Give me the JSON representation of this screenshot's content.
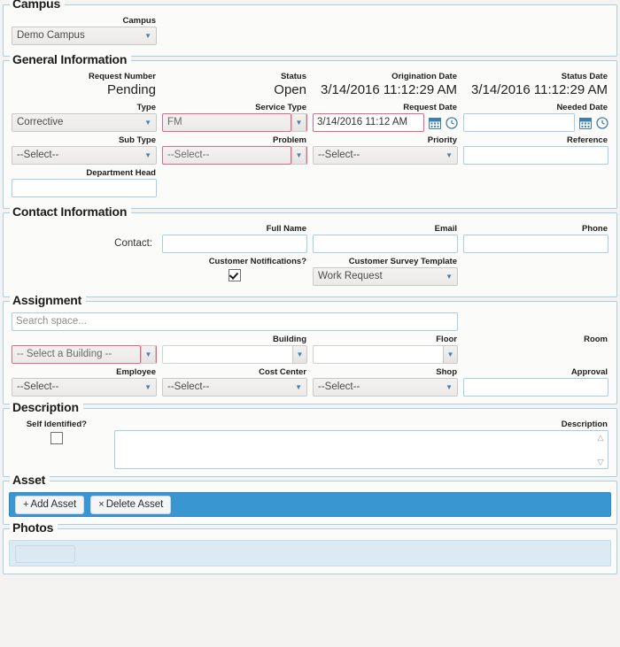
{
  "sections": {
    "campus": {
      "legend": "Campus",
      "campus_label": "Campus",
      "campus_value": "Demo Campus"
    },
    "general": {
      "legend": "General Information",
      "request_number_label": "Request Number",
      "request_number_value": "Pending",
      "status_label": "Status",
      "status_value": "Open",
      "origination_date_label": "Origination Date",
      "origination_date_value": "3/14/2016 11:12:29 AM",
      "status_date_label": "Status Date",
      "status_date_value": "3/14/2016 11:12:29 AM",
      "type_label": "Type",
      "type_value": "Corrective",
      "service_type_label": "Service Type",
      "service_type_value": "FM",
      "request_date_label": "Request Date",
      "request_date_value": "3/14/2016 11:12 AM",
      "needed_date_label": "Needed Date",
      "needed_date_value": "",
      "sub_type_label": "Sub Type",
      "sub_type_value": "--Select--",
      "problem_label": "Problem",
      "problem_value": "--Select--",
      "priority_label": "Priority",
      "priority_value": "--Select--",
      "reference_label": "Reference",
      "reference_value": "",
      "department_head_label": "Department Head",
      "department_head_value": ""
    },
    "contact": {
      "legend": "Contact Information",
      "contact_label": "Contact:",
      "full_name_label": "Full Name",
      "full_name_value": "",
      "email_label": "Email",
      "email_value": "",
      "phone_label": "Phone",
      "phone_value": "",
      "customer_notifications_label": "Customer Notifications?",
      "customer_notifications_checked": true,
      "customer_survey_template_label": "Customer Survey Template",
      "customer_survey_template_value": "Work Request"
    },
    "assignment": {
      "legend": "Assignment",
      "search_placeholder": "Search space...",
      "search_value": "",
      "building_label": "Building",
      "building_value": "-- Select a Building --",
      "floor_label": "Floor",
      "floor_value": "",
      "room_label": "Room",
      "room_value": "",
      "employee_label": "Employee",
      "employee_value": "--Select--",
      "cost_center_label": "Cost Center",
      "cost_center_value": "--Select--",
      "shop_label": "Shop",
      "shop_value": "--Select--",
      "approval_label": "Approval",
      "approval_value": ""
    },
    "description": {
      "legend": "Description",
      "self_identified_label": "Self Identified?",
      "self_identified_checked": false,
      "description_label": "Description",
      "description_value": ""
    },
    "asset": {
      "legend": "Asset",
      "add_asset_label": "Add Asset",
      "add_asset_glyph": "+",
      "delete_asset_label": "Delete Asset",
      "delete_asset_glyph": "×"
    },
    "photos": {
      "legend": "Photos",
      "photo_button_label": ""
    }
  },
  "colors": {
    "section_border": "#a8cfe4",
    "error_border": "#e8628a",
    "toolbar_blue": "#3a96d0",
    "toolbar_light_blue": "#dbeaf3",
    "icon_blue": "#4b7fa8",
    "page_background": "#f4f3f1"
  }
}
